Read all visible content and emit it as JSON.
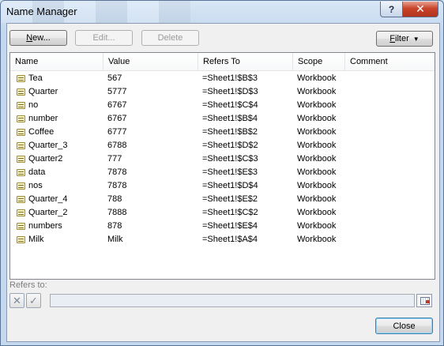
{
  "window": {
    "title": "Name Manager",
    "help_label": "?",
    "close_label": "✕"
  },
  "toolbar": {
    "new_label_u": "N",
    "new_label_rest": "ew...",
    "edit_label": "Edit...",
    "delete_label": "Delete",
    "filter_label_u": "F",
    "filter_label_rest": "ilter",
    "filter_caret": "▼"
  },
  "table": {
    "columns": [
      "Name",
      "Value",
      "Refers To",
      "Scope",
      "Comment"
    ],
    "rows": [
      {
        "name": "Tea",
        "value": "567",
        "refers_to": "=Sheet1!$B$3",
        "scope": "Workbook",
        "comment": ""
      },
      {
        "name": "Quarter",
        "value": "5777",
        "refers_to": "=Sheet1!$D$3",
        "scope": "Workbook",
        "comment": ""
      },
      {
        "name": "no",
        "value": "6767",
        "refers_to": "=Sheet1!$C$4",
        "scope": "Workbook",
        "comment": ""
      },
      {
        "name": "number",
        "value": "6767",
        "refers_to": "=Sheet1!$B$4",
        "scope": "Workbook",
        "comment": ""
      },
      {
        "name": "Coffee",
        "value": "6777",
        "refers_to": "=Sheet1!$B$2",
        "scope": "Workbook",
        "comment": ""
      },
      {
        "name": "Quarter_3",
        "value": "6788",
        "refers_to": "=Sheet1!$D$2",
        "scope": "Workbook",
        "comment": ""
      },
      {
        "name": "Quarter2",
        "value": "777",
        "refers_to": "=Sheet1!$C$3",
        "scope": "Workbook",
        "comment": ""
      },
      {
        "name": "data",
        "value": "7878",
        "refers_to": "=Sheet1!$E$3",
        "scope": "Workbook",
        "comment": ""
      },
      {
        "name": "nos",
        "value": "7878",
        "refers_to": "=Sheet1!$D$4",
        "scope": "Workbook",
        "comment": ""
      },
      {
        "name": "Quarter_4",
        "value": "788",
        "refers_to": "=Sheet1!$E$2",
        "scope": "Workbook",
        "comment": ""
      },
      {
        "name": "Quarter_2",
        "value": "7888",
        "refers_to": "=Sheet1!$C$2",
        "scope": "Workbook",
        "comment": ""
      },
      {
        "name": "numbers",
        "value": "878",
        "refers_to": "=Sheet1!$E$4",
        "scope": "Workbook",
        "comment": ""
      },
      {
        "name": "Milk",
        "value": "Milk",
        "refers_to": "=Sheet1!$A$4",
        "scope": "Workbook",
        "comment": ""
      }
    ]
  },
  "refers": {
    "label": "Refers to:",
    "value": "",
    "cancel_glyph": "✕",
    "ok_glyph": "✓"
  },
  "footer": {
    "close_label": "Close"
  }
}
